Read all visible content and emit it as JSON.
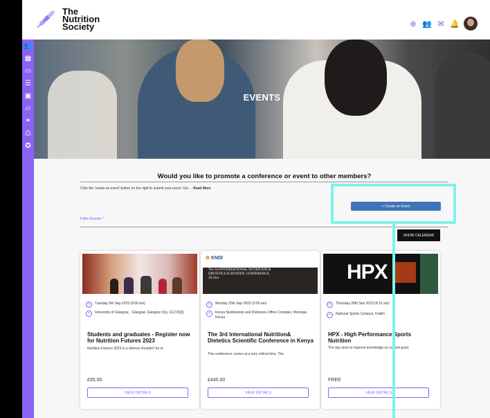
{
  "header": {
    "logo_lines": [
      "The",
      "Nutrition",
      "Society"
    ],
    "icons": [
      "plus-circle-icon",
      "people-icon",
      "mail-icon",
      "notification-icon",
      "avatar"
    ]
  },
  "sidebar": {
    "icons": [
      "members-icon",
      "calendar-icon",
      "chat-icon",
      "document-icon",
      "image-icon",
      "folder-icon",
      "link-icon",
      "print-icon",
      "badge-icon"
    ]
  },
  "hero": {
    "title": "EVENTS"
  },
  "promo": {
    "title": "Would you like to promote a conference or event to other members?",
    "text": "Click the 'create an event' button on the right to submit your event. Our ...",
    "read_more": "Read More",
    "create_button": "+ Create an Event",
    "filter_label": "Filter Events ^",
    "show_calendar": "SHOW CALENDAR"
  },
  "cards": [
    {
      "date": "Tuesday 5th Sep 2023 (9:00 am)",
      "location": "University of Glasgow... Glasgow, Glasgow City, G12 8QQ",
      "title": "Students and graduates - Register now for Nutrition Futures 2023",
      "desc": "Nutrition Futures 2023 is a diverse shouldn't be m",
      "price": "£55.00",
      "button": "VIEW DETAILS"
    },
    {
      "image_logo": "KNDI",
      "image_text": "The 3rd INTERNATIONAL NUTRITION & DIETETICS SCIENTIFIC CONFERENCE, 19-21st",
      "date": "Monday 25th Sep 2023 (9:00 am)",
      "location": "Kenya Nutritionists and Dieticians Office Complex, Molongo, Kenya",
      "title": "The 3rd International Nutrition& Dietetics Scientific Conference in Kenya",
      "desc": "This conference comes at a very critical time. The",
      "price": "£440.00",
      "button": "VIEW DETAILS"
    },
    {
      "image_text": "HPX",
      "date": "Thursday 28th Sep 2023 (8:15 am)",
      "location": "National Sports Campus, Dublin",
      "title": "HPX - High Performance Sports Nutrition",
      "desc": "The day aims to improve knowledge on current pract",
      "price": "FREE",
      "button": "VIEW DETAILS"
    }
  ],
  "colors": {
    "accent": "#8a63f5",
    "button_blue": "#3f74b8",
    "highlight": "#7ff2ec"
  }
}
